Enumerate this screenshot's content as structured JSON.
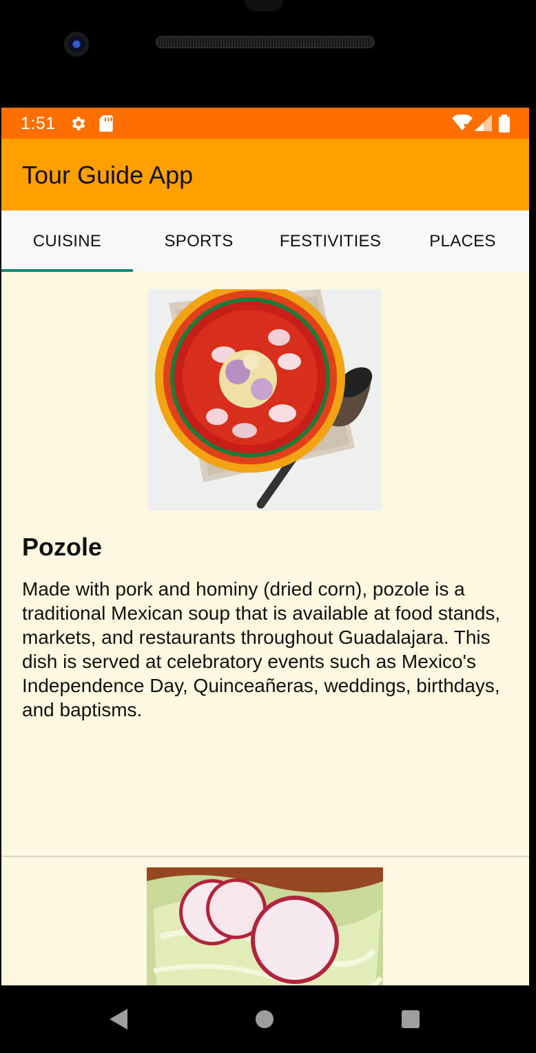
{
  "status_bar": {
    "time": "1:51",
    "icons": [
      "settings-icon",
      "sd-card-icon",
      "wifi-icon",
      "signal-icon",
      "battery-icon"
    ],
    "color": "#ff6f00"
  },
  "app_bar": {
    "title": "Tour Guide App",
    "color": "#ffa000"
  },
  "tabs": [
    {
      "label": "CUISINE",
      "selected": true
    },
    {
      "label": "SPORTS",
      "selected": false
    },
    {
      "label": "FESTIVITIES",
      "selected": false
    },
    {
      "label": "PLACES",
      "selected": false
    }
  ],
  "tab_indicator_color": "#0f8a7a",
  "items": [
    {
      "title": "Pozole",
      "description": "Made with pork and hominy (dried corn), pozole is a traditional Mexican soup that is available at food stands, markets, and restaurants throughout Guadalajara. This dish is served at celebratory events such as Mexico's Independence Day, Quinceañeras, weddings, birthdays, and baptisms.",
      "image": "pozole-bowl-image"
    },
    {
      "title": "",
      "description": "",
      "image": "flautas-image"
    }
  ],
  "nav_bar": {
    "buttons": [
      "back-icon",
      "home-icon",
      "recents-icon"
    ]
  },
  "background_color": "#fff8e1"
}
